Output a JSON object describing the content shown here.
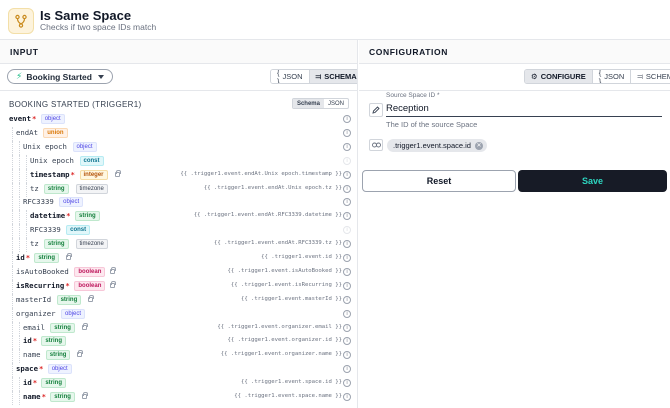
{
  "header": {
    "title": "Is Same Space",
    "subtitle": "Checks if two space IDs match",
    "icon": "git-merge-icon"
  },
  "input_panel": {
    "heading": "INPUT",
    "trigger_select": "Booking Started",
    "view_buttons": [
      "JSON",
      "SCHEMA"
    ],
    "active_view": "SCHEMA",
    "section_title": "BOOKING STARTED (TRIGGER1)",
    "section_toggle": [
      "Schema",
      "JSON"
    ],
    "active_section_toggle": "Schema"
  },
  "tree": [
    {
      "label": "event",
      "required": true,
      "bold": true,
      "type": "object",
      "depth": 0,
      "lock": false,
      "path": ""
    },
    {
      "label": "endAt",
      "required": false,
      "bold": false,
      "type": "union",
      "depth": 1,
      "lock": false,
      "path": ""
    },
    {
      "label": "Unix epoch",
      "required": false,
      "bold": false,
      "type": "object",
      "depth": 2,
      "lock": false,
      "path": ""
    },
    {
      "label": "Unix epoch",
      "required": false,
      "bold": false,
      "type": "const",
      "depth": 3,
      "lock": false,
      "path": "",
      "faint": true
    },
    {
      "label": "timestamp",
      "required": true,
      "bold": true,
      "type": "integer",
      "depth": 3,
      "lock": true,
      "path": "{{ .trigger1.event.endAt.Unix epoch.timestamp }}"
    },
    {
      "label": "tz",
      "required": false,
      "bold": false,
      "type": "string",
      "extra": "timezone",
      "depth": 3,
      "lock": false,
      "path": "{{ .trigger1.event.endAt.Unix epoch.tz }}"
    },
    {
      "label": "RFC3339",
      "required": false,
      "bold": false,
      "type": "object",
      "depth": 2,
      "lock": false,
      "path": ""
    },
    {
      "label": "datetime",
      "required": true,
      "bold": true,
      "type": "string",
      "depth": 3,
      "lock": false,
      "path": "{{ .trigger1.event.endAt.RFC3339.datetime }}"
    },
    {
      "label": "RFC3339",
      "required": false,
      "bold": false,
      "type": "const",
      "depth": 3,
      "lock": false,
      "path": "",
      "faint": true
    },
    {
      "label": "tz",
      "required": false,
      "bold": false,
      "type": "string",
      "extra": "timezone",
      "depth": 3,
      "lock": false,
      "path": "{{ .trigger1.event.endAt.RFC3339.tz }}"
    },
    {
      "label": "id",
      "required": true,
      "bold": true,
      "type": "string",
      "depth": 1,
      "lock": true,
      "path": "{{ .trigger1.event.id }}"
    },
    {
      "label": "isAutoBooked",
      "required": false,
      "bold": false,
      "type": "boolean",
      "depth": 1,
      "lock": true,
      "path": "{{ .trigger1.event.isAutoBooked }}"
    },
    {
      "label": "isRecurring",
      "required": true,
      "bold": true,
      "type": "boolean",
      "depth": 1,
      "lock": true,
      "path": "{{ .trigger1.event.isRecurring }}"
    },
    {
      "label": "masterId",
      "required": false,
      "bold": false,
      "type": "string",
      "depth": 1,
      "lock": true,
      "path": "{{ .trigger1.event.masterId }}"
    },
    {
      "label": "organizer",
      "required": false,
      "bold": false,
      "type": "object",
      "depth": 1,
      "lock": false,
      "path": ""
    },
    {
      "label": "email",
      "required": false,
      "bold": false,
      "type": "string",
      "depth": 2,
      "lock": true,
      "path": "{{ .trigger1.event.organizer.email }}"
    },
    {
      "label": "id",
      "required": true,
      "bold": true,
      "type": "string",
      "depth": 2,
      "lock": false,
      "path": "{{ .trigger1.event.organizer.id }}"
    },
    {
      "label": "name",
      "required": false,
      "bold": false,
      "type": "string",
      "depth": 2,
      "lock": true,
      "path": "{{ .trigger1.event.organizer.name }}"
    },
    {
      "label": "space",
      "required": true,
      "bold": true,
      "type": "object",
      "depth": 1,
      "lock": false,
      "path": ""
    },
    {
      "label": "id",
      "required": true,
      "bold": true,
      "type": "string",
      "depth": 2,
      "lock": false,
      "path": "{{ .trigger1.event.space.id }}"
    },
    {
      "label": "name",
      "required": true,
      "bold": true,
      "type": "string",
      "depth": 2,
      "lock": true,
      "path": "{{ .trigger1.event.space.name }}"
    }
  ],
  "config_panel": {
    "heading": "CONFIGURATION",
    "view_buttons": [
      "CONFIGURE",
      "JSON",
      "SCHEMA"
    ],
    "active_view": "CONFIGURE",
    "field_label": "Source Space ID *",
    "field_value": "Reception",
    "field_help": "The ID of the source Space",
    "chip": ".trigger1.event.space.id",
    "reset_label": "Reset",
    "save_label": "Save"
  }
}
